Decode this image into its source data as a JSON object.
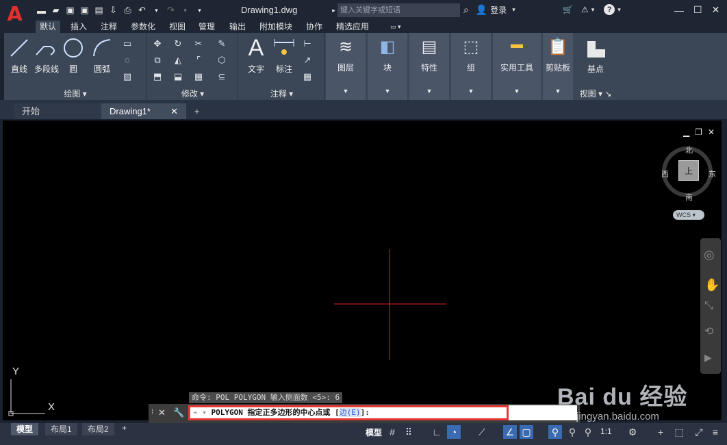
{
  "app": {
    "doc_title": "Drawing1.dwg",
    "search_placeholder": "键入关键字或短语",
    "user": "登录",
    "qat": [
      "new-file",
      "open",
      "save",
      "save-as",
      "plot-publish",
      "import",
      "print",
      "undo",
      "redo"
    ]
  },
  "ribbon_tabs": [
    "默认",
    "插入",
    "注释",
    "参数化",
    "视图",
    "管理",
    "输出",
    "附加模块",
    "协作",
    "精选应用"
  ],
  "ribbon": {
    "draw": {
      "label": "绘图",
      "tools": [
        "直线",
        "多段线",
        "圆",
        "圆弧"
      ]
    },
    "modify": {
      "label": "修改"
    },
    "annotate": {
      "label": "注释",
      "tools": [
        "文字",
        "标注"
      ]
    },
    "groups": [
      "图层",
      "块",
      "特性",
      "组",
      "实用工具",
      "剪贴板"
    ],
    "view": {
      "label": "视图",
      "tool": "基点"
    }
  },
  "doc_tabs": [
    "开始",
    "Drawing1*"
  ],
  "viewcube": {
    "north": "北",
    "south": "南",
    "east": "东",
    "west": "西",
    "face": "上",
    "wcs": "WCS"
  },
  "ucs": {
    "x": "X",
    "y": "Y"
  },
  "command": {
    "history": "命令: POL POLYGON 输入侧面数 <5>: 6",
    "prompt": "POLYGON 指定正多边形的中心点或 [",
    "option": "边(E)",
    "suffix": "]:"
  },
  "layout_tabs": [
    "模型",
    "布局1",
    "布局2"
  ],
  "status": {
    "model": "模型",
    "scale": "1:1"
  },
  "watermark": {
    "brand": "Bai du 经验",
    "url": "jingyan.baidu.com"
  }
}
